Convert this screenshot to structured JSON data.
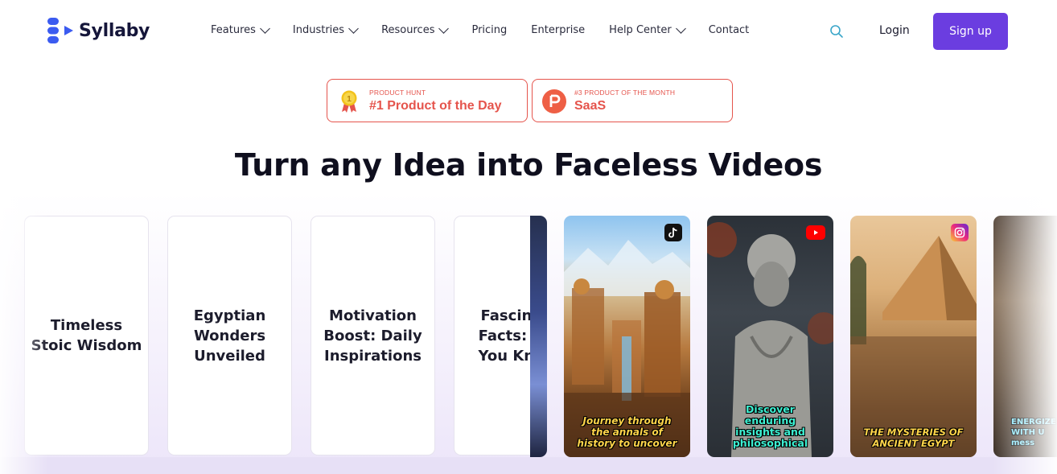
{
  "brand": {
    "name": "Syllaby",
    "accent": "#6b3de0"
  },
  "nav": {
    "items": [
      {
        "label": "Features",
        "dropdown": true
      },
      {
        "label": "Industries",
        "dropdown": true
      },
      {
        "label": "Resources",
        "dropdown": true
      },
      {
        "label": "Pricing",
        "dropdown": false
      },
      {
        "label": "Enterprise",
        "dropdown": false
      },
      {
        "label": "Help Center",
        "dropdown": true
      },
      {
        "label": "Contact",
        "dropdown": false
      }
    ],
    "search_icon": "search-icon",
    "login_label": "Login",
    "signup_label": "Sign up"
  },
  "badges": [
    {
      "source": "PRODUCT HUNT",
      "title": "#1 Product of the Day",
      "icon": "medal-icon",
      "color": "#e5544c"
    },
    {
      "source": "#3 PRODUCT OF THE MONTH",
      "title": "SaaS",
      "icon": "producthunt-icon",
      "color": "#e5544c"
    }
  ],
  "headline": "Turn any Idea into Faceless Videos",
  "idea_cards": [
    {
      "label": "Timeless\nStoic Wisdom"
    },
    {
      "label": "Egyptian\nWonders\nUnveiled"
    },
    {
      "label": "Motivation\nBoost: Daily\nInspirations"
    },
    {
      "label": "Fascina\nFacts: D\nYou Kno"
    }
  ],
  "video_cards": [
    {
      "caption": "Journey through\nthe annals of\nhistory to uncover",
      "platform": "tiktok-icon",
      "caption_color": "#ffd54a"
    },
    {
      "caption": "Discover\nenduring\ninsights and\nphilosophical",
      "platform": "youtube-icon",
      "caption_color": "#3cf0d2"
    },
    {
      "caption": "THE MYSTERIES OF\nANCIENT EGYPT",
      "platform": "instagram-icon",
      "caption_color": "#ffd54a"
    },
    {
      "caption": "ENERGIZE\nWITH U\nmess",
      "platform": "",
      "caption_color": "#7fe8ff"
    }
  ]
}
